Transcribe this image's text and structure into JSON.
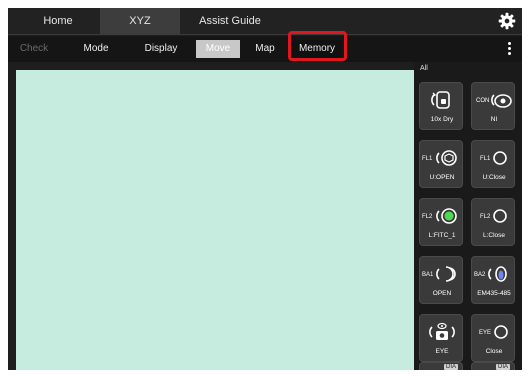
{
  "topbar": {
    "tabs": [
      {
        "label": "Home",
        "active": false
      },
      {
        "label": "XYZ",
        "active": true
      },
      {
        "label": "Assist Guide",
        "active": false
      }
    ],
    "settings_icon": "gear-icon"
  },
  "menubar": {
    "items": [
      {
        "label": "Check",
        "state": "disabled"
      },
      {
        "label": "Mode",
        "state": "normal"
      },
      {
        "label": "Display",
        "state": "normal"
      },
      {
        "label": "Move",
        "state": "selected"
      },
      {
        "label": "Map",
        "state": "normal"
      },
      {
        "label": "Memory",
        "state": "highlighted"
      }
    ],
    "more_icon": "kebab-menu-icon",
    "highlight_color": "#e0171f"
  },
  "viewport": {
    "background": "#c5ecdf"
  },
  "panel": {
    "title": "All",
    "tiles": [
      {
        "prefix": "",
        "label": "10x Dry",
        "icon": "objective-icon"
      },
      {
        "prefix": "CON",
        "label": "NI",
        "icon": "condenser-icon"
      },
      {
        "prefix": "FL1",
        "label": "U:OPEN",
        "icon": "cube-turret-icon"
      },
      {
        "prefix": "FL1",
        "label": "U:Close",
        "icon": "shutter-closed-icon"
      },
      {
        "prefix": "FL2",
        "label": "L:FITC_1",
        "icon": "filter-green-icon"
      },
      {
        "prefix": "FL2",
        "label": "L:Close",
        "icon": "shutter-closed-icon"
      },
      {
        "prefix": "BA1",
        "label": "OPEN",
        "icon": "barrier-filter-icon"
      },
      {
        "prefix": "BA2",
        "label": "EM435-485",
        "icon": "barrier-filter-blue-icon"
      },
      {
        "prefix": "",
        "label": "EYE",
        "icon": "eyepiece-camera-icon"
      },
      {
        "prefix": "EYE",
        "label": "Close",
        "icon": "shutter-closed-icon"
      }
    ],
    "partial_tiles": [
      {
        "badge": "DIA"
      },
      {
        "badge": "DIA"
      }
    ]
  }
}
